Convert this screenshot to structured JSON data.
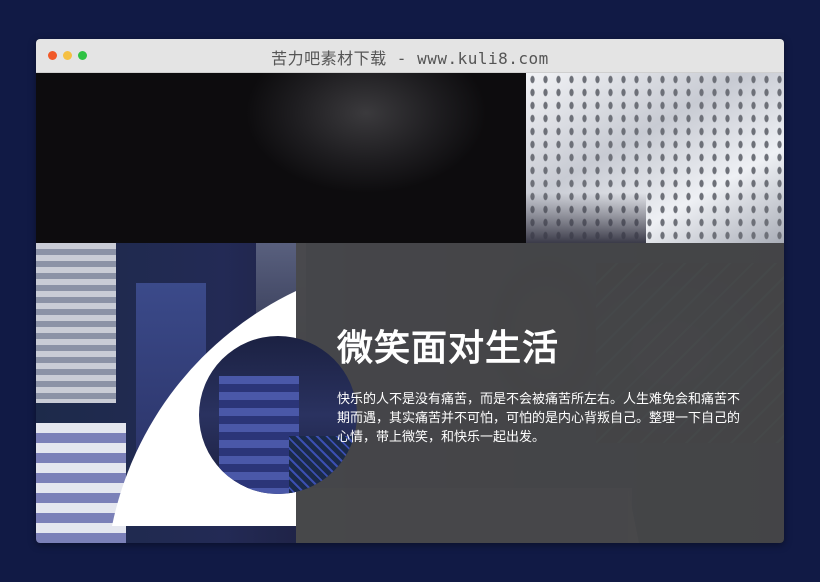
{
  "window": {
    "title": "苦力吧素材下载 - www.kuli8.com",
    "controls": {
      "close_color": "#f15a29",
      "minimize_color": "#f5c043",
      "maximize_color": "#2fc244"
    }
  },
  "hero": {
    "heading": "微笑面对生活",
    "paragraph": "快乐的人不是没有痛苦，而是不会被痛苦所左右。人生难免会和痛苦不期而遇，其实痛苦并不可怕，可怕的是内心背叛自己。整理一下自己的心情，带上微笑，和快乐一起出发。",
    "overlay_color": "#48484a",
    "shape_color": "#ffffff"
  }
}
